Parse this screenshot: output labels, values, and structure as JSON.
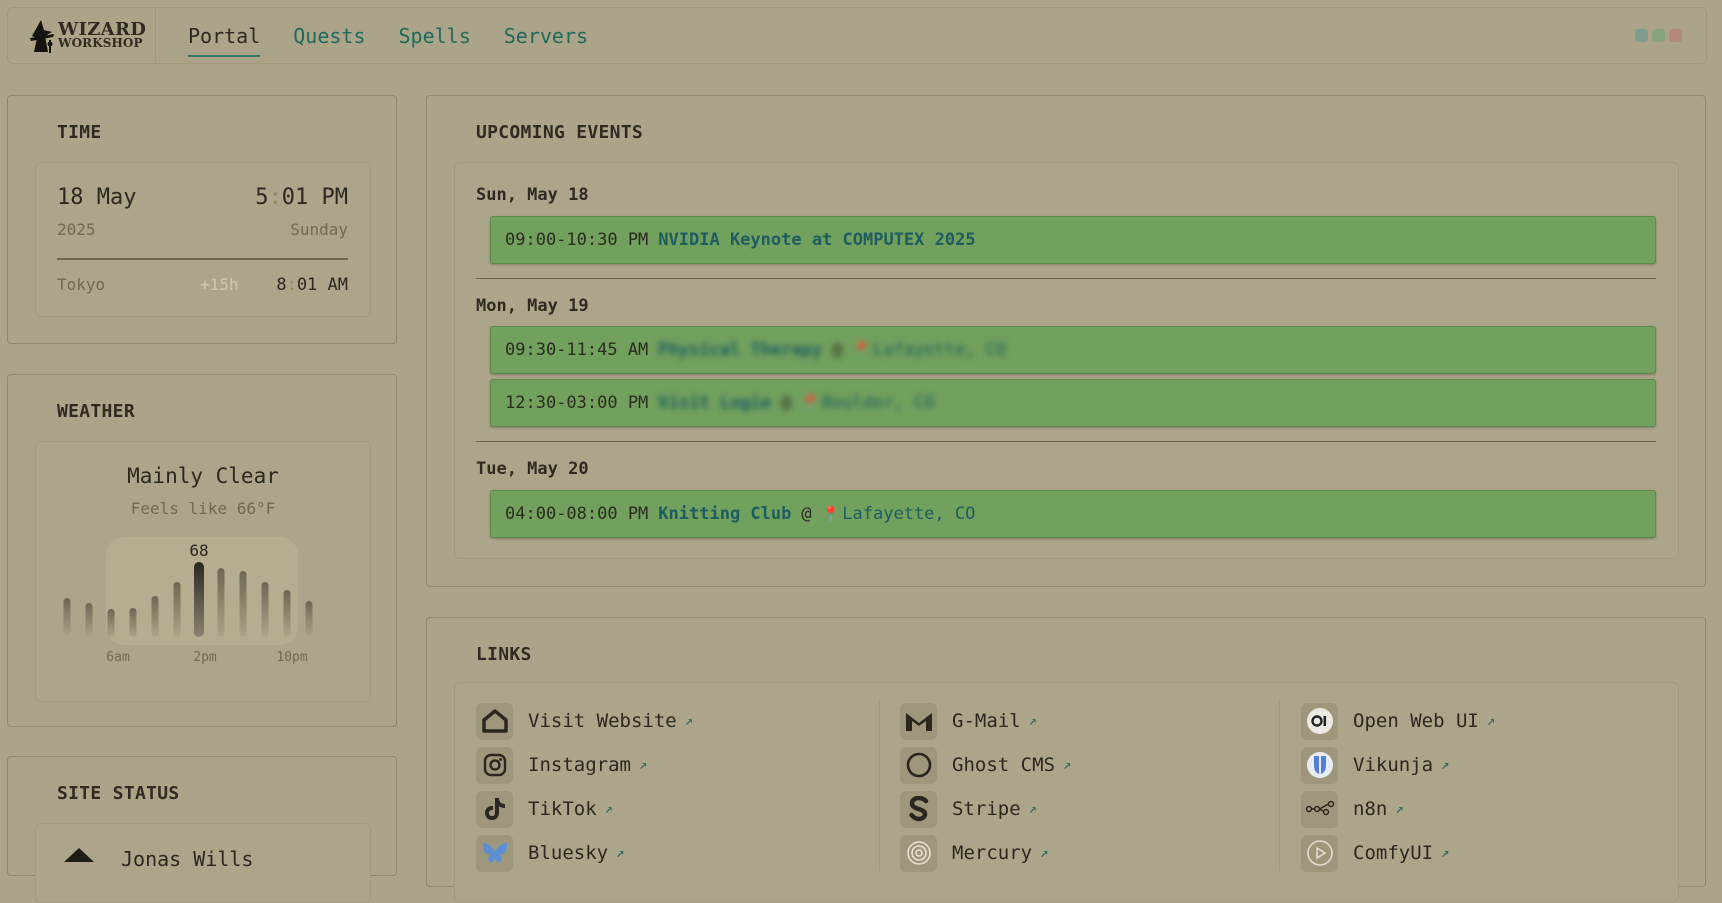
{
  "header": {
    "logo_line1": "WIZARD",
    "logo_line2": "WORKSHOP",
    "nav": [
      {
        "label": "Portal",
        "active": true
      },
      {
        "label": "Quests",
        "active": false
      },
      {
        "label": "Spells",
        "active": false
      },
      {
        "label": "Servers",
        "active": false
      }
    ],
    "theme_dots": [
      "#7f9e8f",
      "#86a47b",
      "#b58a7d"
    ]
  },
  "time": {
    "title": "TIME",
    "date": "18 May",
    "hour": "5",
    "minute": "01 PM",
    "year": "2025",
    "weekday": "Sunday",
    "tz_city": "Tokyo",
    "tz_offset": "+15h",
    "tz_hour": "8",
    "tz_minute": "01 AM"
  },
  "weather": {
    "title": "WEATHER",
    "condition": "Mainly Clear",
    "feels_like": "Feels like 66°F",
    "current_temp_label": "68",
    "axis_labels": [
      "6am",
      "2pm",
      "10pm"
    ]
  },
  "chart_data": {
    "type": "bar",
    "title": "",
    "values": [
      39,
      34,
      28,
      29,
      41,
      55,
      75,
      69,
      66,
      55,
      47,
      36
    ],
    "highlight_index": 6,
    "highlight_label": "68",
    "x_tick_labels": [
      "6am",
      "2pm",
      "10pm"
    ],
    "ylim": [
      0,
      80
    ]
  },
  "site_status": {
    "title": "SITE STATUS",
    "name": "Jonas Wills"
  },
  "events": {
    "title": "UPCOMING EVENTS",
    "days": [
      {
        "label": "Sun, May 18",
        "items": [
          {
            "time": "09:00-10:30 PM",
            "title": "NVIDIA Keynote at COMPUTEX 2025",
            "at": "",
            "location": "",
            "blurred": false
          }
        ]
      },
      {
        "label": "Mon, May 19",
        "items": [
          {
            "time": "09:30-11:45 AM",
            "title": "Physical Therapy",
            "at": "@",
            "location": "Lafayette, CO",
            "blurred": true
          },
          {
            "time": "12:30-03:00 PM",
            "title": "Visit Logie",
            "at": "@",
            "location": "Boulder, CO",
            "blurred": true
          }
        ]
      },
      {
        "label": "Tue, May 20",
        "items": [
          {
            "time": "04:00-08:00 PM",
            "title": "Knitting Club",
            "at": "@",
            "location": "Lafayette, CO",
            "blurred": false
          }
        ]
      }
    ]
  },
  "links": {
    "title": "LINKS",
    "arrow": "↗",
    "columns": [
      [
        {
          "label": "Visit Website",
          "icon": "house-icon"
        },
        {
          "label": "Instagram",
          "icon": "instagram-icon"
        },
        {
          "label": "TikTok",
          "icon": "tiktok-icon"
        },
        {
          "label": "Bluesky",
          "icon": "bluesky-icon"
        }
      ],
      [
        {
          "label": "G-Mail",
          "icon": "gmail-icon"
        },
        {
          "label": "Ghost CMS",
          "icon": "ghost-icon"
        },
        {
          "label": "Stripe",
          "icon": "stripe-icon"
        },
        {
          "label": "Mercury",
          "icon": "mercury-icon"
        }
      ],
      [
        {
          "label": "Open Web UI",
          "icon": "openwebui-icon"
        },
        {
          "label": "Vikunja",
          "icon": "vikunja-icon"
        },
        {
          "label": "n8n",
          "icon": "n8n-icon"
        },
        {
          "label": "ComfyUI",
          "icon": "comfyui-icon"
        }
      ]
    ]
  }
}
